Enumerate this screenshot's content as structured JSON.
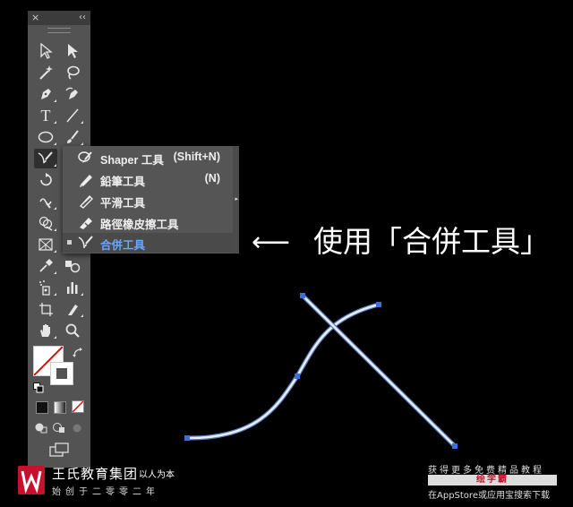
{
  "panel": {
    "close_label": "×",
    "collapse_label": "‹‹"
  },
  "tools": [
    {
      "name": "selection-tool-icon"
    },
    {
      "name": "direct-selection-tool-icon"
    },
    {
      "name": "magic-wand-tool-icon"
    },
    {
      "name": "lasso-tool-icon"
    },
    {
      "name": "pen-tool-icon"
    },
    {
      "name": "curvature-tool-icon"
    },
    {
      "name": "type-tool-icon",
      "text": "T"
    },
    {
      "name": "line-segment-tool-icon"
    },
    {
      "name": "ellipse-tool-icon"
    },
    {
      "name": "paintbrush-tool-icon"
    },
    {
      "name": "shaper-tool-icon"
    },
    {
      "name": "eraser-tool-icon"
    },
    {
      "name": "rotate-tool-icon"
    },
    {
      "name": "scale-tool-icon"
    },
    {
      "name": "puppet-warp-tool-icon"
    },
    {
      "name": "free-transform-tool-icon"
    },
    {
      "name": "shape-builder-tool-icon"
    },
    {
      "name": "live-paint-bucket-tool-icon"
    },
    {
      "name": "perspective-grid-tool-icon"
    },
    {
      "name": "mesh-tool-icon"
    },
    {
      "name": "eyedropper-tool-icon"
    },
    {
      "name": "blend-tool-icon"
    },
    {
      "name": "symbol-sprayer-tool-icon"
    },
    {
      "name": "column-graph-tool-icon"
    },
    {
      "name": "artboard-tool-icon"
    },
    {
      "name": "slice-tool-icon"
    },
    {
      "name": "hand-tool-icon"
    },
    {
      "name": "zoom-tool-icon"
    }
  ],
  "flyout": {
    "items": [
      {
        "label": "Shaper 工具",
        "shortcut": "(Shift+N)",
        "icon": "shaper-tool-icon"
      },
      {
        "label": "鉛筆工具",
        "shortcut": "(N)",
        "icon": "pencil-tool-icon"
      },
      {
        "label": "平滑工具",
        "shortcut": "",
        "icon": "smooth-tool-icon"
      },
      {
        "label": "路徑橡皮擦工具",
        "shortcut": "",
        "icon": "path-eraser-tool-icon"
      },
      {
        "label": "合併工具",
        "shortcut": "",
        "icon": "join-tool-icon",
        "selected": true
      }
    ]
  },
  "annotation": {
    "arrow": "⟵",
    "text": "使用「合併工具」"
  },
  "colors": {
    "panel_bg": "#535353",
    "highlight": "#6aa6ff",
    "path_stroke": "#dfe8f5",
    "anchor": "#3b6fe0",
    "brand_red": "#c8102e"
  },
  "footer": {
    "brand_name": "王氏教育集团",
    "brand_slogan": "以人为本",
    "brand_sub": "始创于二零零二年",
    "ad_line1": "获得更多免费精品教程",
    "ad_line2": "绘学霸",
    "ad_line3": "在AppStore或应用宝搜索下载"
  }
}
